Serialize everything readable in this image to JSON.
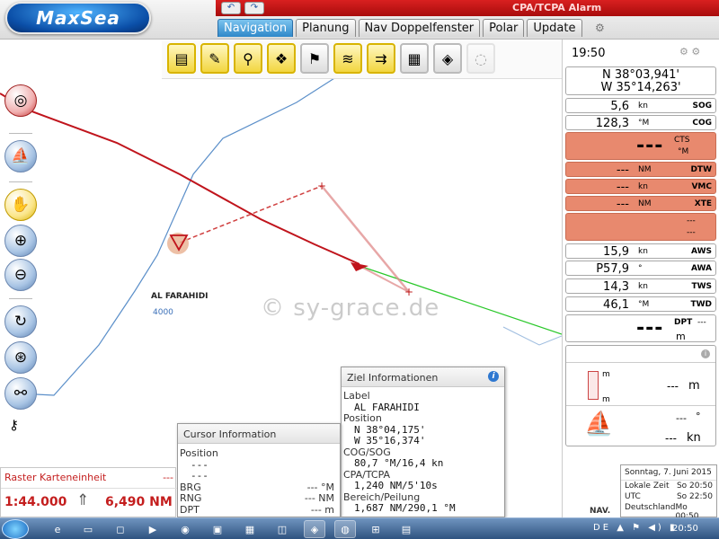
{
  "app": {
    "logo": "MaxSea",
    "alarm_title": "CPA/TCPA Alarm"
  },
  "tabs": [
    {
      "label": "Navigation",
      "active": true
    },
    {
      "label": "Planung",
      "active": false
    },
    {
      "label": "Nav Doppelfenster",
      "active": false
    },
    {
      "label": "Polar",
      "active": false
    },
    {
      "label": "Update",
      "active": false
    }
  ],
  "toolbar_icons": [
    "tide-chart-icon",
    "route-icon",
    "weather-buoy-icon",
    "layers-icon",
    "windsock-icon",
    "wind-arrows-icon",
    "current-arrows-icon",
    "satellite-image-icon",
    "pressure-map-icon",
    "disabled-tool-icon"
  ],
  "map": {
    "target_name": "AL FARAHIDI",
    "depth": "4000",
    "watermark": "© sy-grace.de"
  },
  "panel": {
    "time": "19:50",
    "lat": "N 38°03,941'",
    "lon": "W 35°14,263'",
    "sog": {
      "value": "5,6",
      "unit": "kn",
      "name": "SOG"
    },
    "cog": {
      "value": "128,3",
      "unit": "°M",
      "name": "COG"
    },
    "cts": {
      "value": "---",
      "name": "CTS",
      "unit": "°M"
    },
    "dtw": {
      "value": "---",
      "unit": "NM",
      "name": "DTW"
    },
    "vmc": {
      "value": "---",
      "unit": "kn",
      "name": "VMC"
    },
    "xte": {
      "value": "---",
      "unit": "NM",
      "name": "XTE"
    },
    "extra": {
      "line1": "---",
      "line2": "---"
    },
    "aws": {
      "value": "15,9",
      "unit": "kn",
      "name": "AWS"
    },
    "awa": {
      "value": "P57,9",
      "unit": "°",
      "name": "AWA"
    },
    "tws": {
      "value": "14,3",
      "unit": "kn",
      "name": "TWS"
    },
    "twd": {
      "value": "46,1",
      "unit": "°M",
      "name": "TWD"
    },
    "dpt": {
      "value": "---",
      "name": "DPT",
      "unit": "m",
      "extra": "---"
    },
    "gauge": {
      "m_top": "m",
      "m_bottom": "m",
      "value": "---",
      "unit": "m"
    },
    "wind": {
      "angle": "---",
      "angle_unit": "°",
      "speed": "---",
      "speed_unit": "kn"
    },
    "nav_label": "NAV."
  },
  "ziel": {
    "title": "Ziel Informationen",
    "label_title": "Label",
    "label": "AL FARAHIDI",
    "position_title": "Position",
    "lat": "N 38°04,175'",
    "lon": "W 35°16,374'",
    "cogsog_title": "COG/SOG",
    "cogsog": "80,7 °M/16,4 kn",
    "cpa_title": "CPA/TCPA",
    "cpa": "1,240 NM/5'10s",
    "bereich_title": "Bereich/Peilung",
    "bereich": "1,687 NM/290,1 °M"
  },
  "cursor": {
    "title": "Cursor Information",
    "position_title": "Position",
    "lat": "---",
    "lon": "---",
    "brg": {
      "label": "BRG",
      "value": "--- °M"
    },
    "rng": {
      "label": "RNG",
      "value": "--- NM"
    },
    "dpt": {
      "label": "DPT",
      "value": "--- m"
    }
  },
  "scale": {
    "title": "Raster Karteneinheit",
    "dash": "---",
    "ratio": "1:44.000",
    "distance": "6,490 NM"
  },
  "clock": {
    "date": "Sonntag, 7. Juni 2015",
    "rows": [
      {
        "label": "Lokale Zeit",
        "value": "So 20:50"
      },
      {
        "label": "UTC",
        "value": "So 22:50"
      },
      {
        "label": "Deutschland",
        "value": "Mo 00:50"
      }
    ]
  },
  "taskbar": {
    "time": "20:50",
    "tray": "DE ▲ ⚑ ◀) ▮"
  },
  "colors": {
    "track_red": "#c0141c",
    "route_blue": "#5b8fc9",
    "cpa_pink": "#e08a8a",
    "cpa_green": "#2bc82b",
    "alarm_red": "#b81010",
    "salmon": "#e8896e"
  }
}
